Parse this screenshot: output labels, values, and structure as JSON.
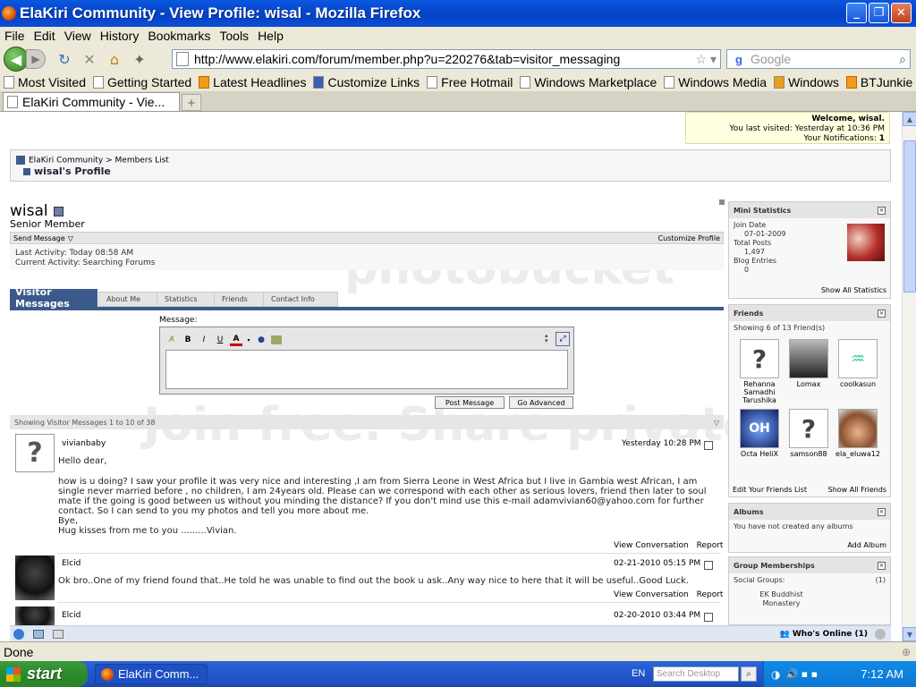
{
  "window": {
    "title": "ElaKiri Community - View Profile: wisal - Mozilla Firefox"
  },
  "menu": [
    "File",
    "Edit",
    "View",
    "History",
    "Bookmarks",
    "Tools",
    "Help"
  ],
  "nav": {
    "url": "http://www.elakiri.com/forum/member.php?u=220276&tab=visitor_messaging",
    "search_placeholder": "Google",
    "search_engine_icon": "google-icon"
  },
  "bookmarks": [
    "Most Visited",
    "Getting Started",
    "Latest Headlines",
    "Customize Links",
    "Free Hotmail",
    "Windows Marketplace",
    "Windows Media",
    "Windows",
    "BTJunkie - Hebrow For ..."
  ],
  "tab": {
    "label": "ElaKiri Community - Vie..."
  },
  "welcome": {
    "line1": "Welcome, wisal.",
    "line2": "You last visited: Yesterday at 10:36 PM",
    "line3": "Your Notifications:",
    "notif_count": "1"
  },
  "breadcrumb": {
    "parent": "ElaKiri Community > Members List",
    "current": "wisal's Profile"
  },
  "profile": {
    "username": "wisal",
    "rank": "Senior Member",
    "send_message": "Send Message",
    "customize": "Customize Profile",
    "last_activity": "Last Activity: Today 08:58 AM",
    "current_activity": "Current Activity: Searching Forums"
  },
  "tabs": [
    "Visitor Messages",
    "About Me",
    "Statistics",
    "Friends",
    "Contact Info"
  ],
  "editor": {
    "label": "Message:",
    "post": "Post Message",
    "advanced": "Go Advanced"
  },
  "showing": "Showing Visitor Messages 1 to 10 of 38",
  "messages": [
    {
      "author": "vivianbaby",
      "date": "Yesterday",
      "time": "10:28 PM",
      "greeting": "Hello dear,",
      "body": "how is u doing? I saw your profile it was very nice and interesting ,I am from Sierra Leone in West Africa but I live in Gambia west African, I am single never married before , no children, I am 24years old. Please can we correspond with each other as serious lovers, friend then later to soul mate if the going is good between us without you minding the distance? If you don't mind use this e-mail adamvivian60@yahoo.com for further contact. So I can send to you my photos and tell you more about me.",
      "bye": "Bye,",
      "sign": "Hug kisses from me to you .........Vivian.",
      "view": "View Conversation",
      "report": "Report"
    },
    {
      "author": "Elcid",
      "date": "02-21-2010",
      "time": "05:15 PM",
      "body": "Ok bro..One of my friend found that..He told he was unable to find out the book u ask..Any way nice to here that it will be useful..Good Luck.",
      "view": "View Conversation",
      "report": "Report"
    },
    {
      "author": "Elcid",
      "date": "02-20-2010",
      "time": "03:44 PM"
    }
  ],
  "sidebar": {
    "mini": {
      "title": "Mini Statistics",
      "join_label": "Join Date",
      "join": "07-01-2009",
      "posts_label": "Total Posts",
      "posts": "1,497",
      "blog_label": "Blog Entries",
      "blog": "0",
      "link": "Show All Statistics"
    },
    "friends": {
      "title": "Friends",
      "showing": "Showing 6 of 13 Friend(s)",
      "list": [
        "Rehanna Samadhi Tarushika",
        "Lomax",
        "coolkasun",
        "Octa HeliX",
        "samson88",
        "ela_eluwa12"
      ],
      "edit": "Edit Your Friends List",
      "all": "Show All Friends"
    },
    "albums": {
      "title": "Albums",
      "text": "You have not created any albums",
      "add": "Add Album"
    },
    "groups": {
      "title": "Group Memberships",
      "social": "Social Groups:",
      "count": "(1)",
      "item": "EK Buddhist Monastery"
    }
  },
  "bottombar": {
    "whos_online": "Who's Online (1)"
  },
  "watermark": {
    "line1": "photobucket",
    "line2": "Join free. Share privately."
  },
  "status": "Done",
  "taskbar": {
    "start": "start",
    "item": "ElaKiri Comm...",
    "lang": "EN",
    "desk_search": "Search Desktop",
    "clock": "7:12 AM"
  }
}
